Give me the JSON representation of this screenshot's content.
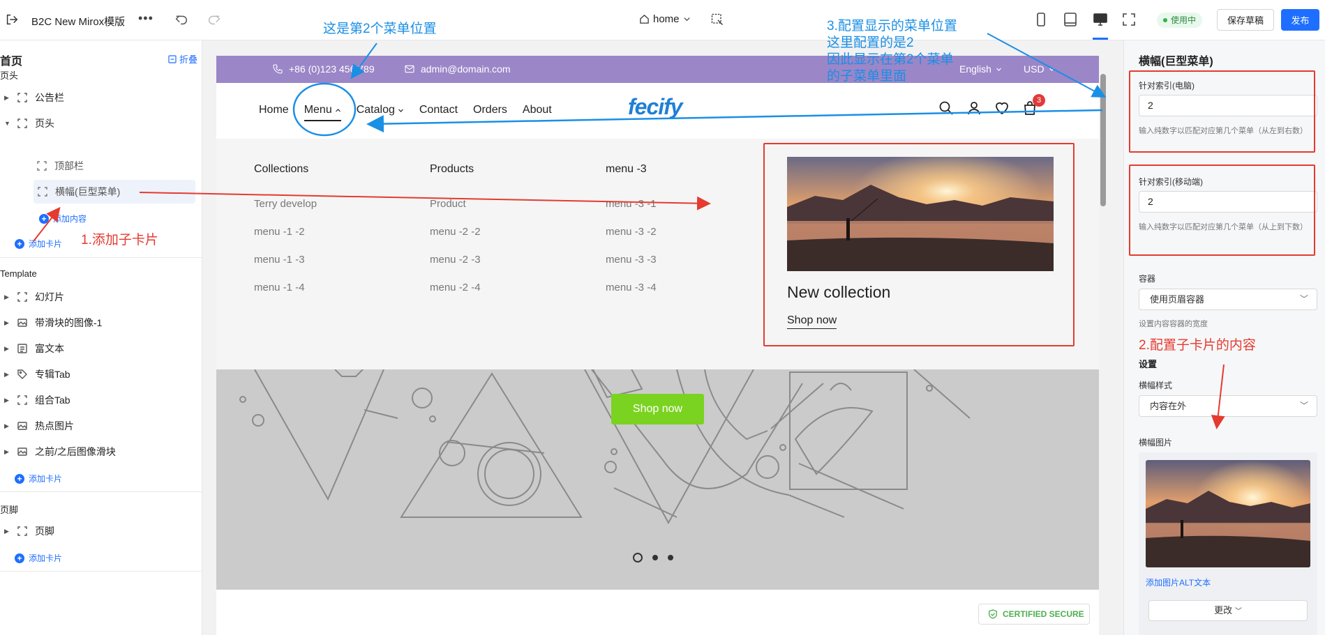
{
  "topbar": {
    "title": "B2C New Mirox模版",
    "more": "•••",
    "page_selector": "home",
    "status_badge": "使用中",
    "save_draft": "保存草稿",
    "publish": "发布"
  },
  "sidebar": {
    "page_title": "首页",
    "collapse": "折叠",
    "header_section": "页头",
    "header_items": [
      {
        "label": "公告栏"
      },
      {
        "label": "页头"
      },
      {
        "label": "顶部栏"
      },
      {
        "label": "横幅(巨型菜单)"
      }
    ],
    "add_content": "添加内容",
    "add_card": "添加卡片",
    "template_section": "Template",
    "template_items": [
      {
        "label": "幻灯片"
      },
      {
        "label": "带滑块的图像-1"
      },
      {
        "label": "富文本"
      },
      {
        "label": "专辑Tab"
      },
      {
        "label": "组合Tab"
      },
      {
        "label": "热点图片"
      },
      {
        "label": "之前/之后图像滑块"
      }
    ],
    "footer_section": "页脚",
    "footer_items": [
      {
        "label": "页脚"
      }
    ]
  },
  "preview": {
    "announcement": {
      "phone": "+86 (0)123 456 789",
      "email": "admin@domain.com",
      "language": "English",
      "currency": "USD"
    },
    "nav": [
      "Home",
      "Menu",
      "Catalog",
      "Contact",
      "Orders",
      "About"
    ],
    "logo": {
      "text": "fecify"
    },
    "cart_count": "3",
    "mega_menu": {
      "columns": [
        {
          "title": "Collections",
          "links": [
            "Terry develop",
            "menu -1 -2",
            "menu -1 -3",
            "menu -1 -4"
          ]
        },
        {
          "title": "Products",
          "links": [
            "Product",
            "menu -2 -2",
            "menu -2 -3",
            "menu -2 -4"
          ]
        },
        {
          "title": "menu -3",
          "links": [
            "menu -3 -1",
            "menu -3 -2",
            "menu -3 -3",
            "menu -3 -4"
          ]
        }
      ],
      "promo_title": "New collection",
      "promo_link": "Shop now"
    },
    "hero_button": "Shop now",
    "certified": "CERTIFIED SECURE"
  },
  "right_panel": {
    "title": "横幅(巨型菜单)",
    "pc_index_label": "针对索引(电脑)",
    "pc_index_value": "2",
    "pc_index_hint": "输入纯数字以匹配对应第几个菜单（从左到右数）",
    "mobile_index_label": "针对索引(移动端)",
    "mobile_index_value": "2",
    "mobile_index_hint": "输入纯数字以匹配对应第几个菜单（从上到下数）",
    "container_label": "容器",
    "container_value": "使用页眉容器",
    "container_hint": "设置内容容器的宽度",
    "settings_section": "设置",
    "banner_style_label": "横幅样式",
    "banner_style_value": "内容在外",
    "banner_image_label": "横幅图片",
    "add_alt": "添加图片ALT文本",
    "change": "更改"
  },
  "annotations": {
    "menu_position": "这是第2个菜单位置",
    "config_position": "3.配置显示的菜单位置\n这里配置的是2\n因此显示在第2个菜单\n的子菜单里面",
    "add_sub_card": "1.添加子卡片",
    "config_content": "2.配置子卡片的内容"
  },
  "colors": {
    "accent": "#1e6fff",
    "announcement_bg": "#9b86c8",
    "hero_button": "#7bd321",
    "annotation_red": "#e53a2f",
    "annotation_blue": "#1a8fe6"
  }
}
